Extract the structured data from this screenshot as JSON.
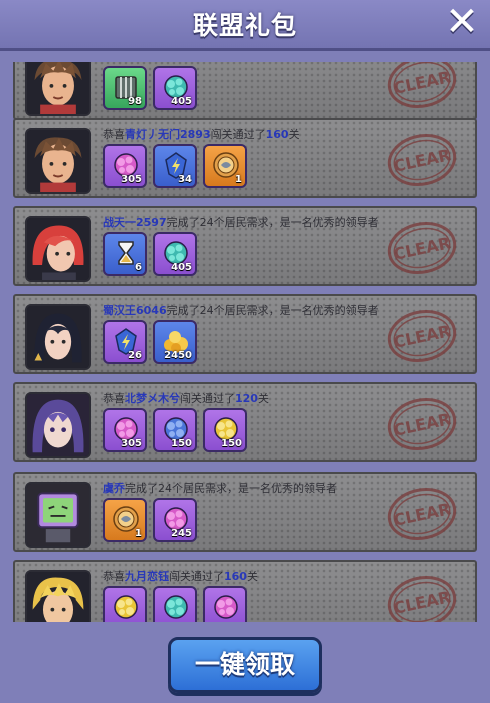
{
  "header": {
    "title": "联盟礼包",
    "close_icon": "close-icon"
  },
  "colors": {
    "highlight": "#2838b8",
    "panel": "#7f7fb8",
    "button": "#3b80e0"
  },
  "cards": [
    {
      "avatar": "avatar-brown-hair",
      "message": [],
      "stamp": "CLEAR",
      "items": [
        {
          "icon": "cage-icon",
          "color": "green",
          "count": "98"
        },
        {
          "icon": "teal-orb-icon",
          "color": "purple",
          "count": "405"
        }
      ]
    },
    {
      "avatar": "avatar-brown-hair",
      "message": [
        {
          "t": "恭喜",
          "hl": false
        },
        {
          "t": "青灯丿无门2893",
          "hl": true
        },
        {
          "t": "闯关通过了",
          "hl": false
        },
        {
          "t": "160",
          "hl": true
        },
        {
          "t": "关",
          "hl": false
        }
      ],
      "stamp": "CLEAR",
      "items": [
        {
          "icon": "pink-orb-icon",
          "color": "purple",
          "count": "305"
        },
        {
          "icon": "lightning-crystal-icon",
          "color": "blue",
          "count": "34"
        },
        {
          "icon": "gold-medal-icon",
          "color": "orange",
          "count": "1"
        }
      ]
    },
    {
      "avatar": "avatar-red-hair",
      "message": [
        {
          "t": "战天一2597",
          "hl": true
        },
        {
          "t": "完成了24个居民需求，是一名优秀的领导者",
          "hl": false
        }
      ],
      "stamp": "CLEAR",
      "items": [
        {
          "icon": "hourglass-icon",
          "color": "blue",
          "count": "6"
        },
        {
          "icon": "teal-orb-icon",
          "color": "purple",
          "count": "405"
        }
      ]
    },
    {
      "avatar": "avatar-dark-hair",
      "message": [
        {
          "t": "蜀汉王6046",
          "hl": true
        },
        {
          "t": "完成了24个居民需求，是一名优秀的领导者",
          "hl": false
        }
      ],
      "stamp": "CLEAR",
      "items": [
        {
          "icon": "lightning-crystal-icon",
          "color": "purple",
          "count": "26"
        },
        {
          "icon": "gold-pile-icon",
          "color": "blue",
          "count": "2450"
        }
      ]
    },
    {
      "avatar": "avatar-purple-hair",
      "message": [
        {
          "t": "恭喜",
          "hl": false
        },
        {
          "t": "北梦メ木兮",
          "hl": true
        },
        {
          "t": "闯关通过了",
          "hl": false
        },
        {
          "t": "120",
          "hl": true
        },
        {
          "t": "关",
          "hl": false
        }
      ],
      "stamp": "CLEAR",
      "items": [
        {
          "icon": "pink-orb-icon",
          "color": "purple",
          "count": "305"
        },
        {
          "icon": "blue-orb-icon",
          "color": "purple",
          "count": "150"
        },
        {
          "icon": "yellow-orb-icon",
          "color": "purple",
          "count": "150"
        }
      ]
    },
    {
      "avatar": "avatar-robot",
      "message": [
        {
          "t": "虞乔",
          "hl": true
        },
        {
          "t": "完成了24个居民需求，是一名优秀的领导者",
          "hl": false
        }
      ],
      "stamp": "CLEAR",
      "items": [
        {
          "icon": "gold-medal-icon",
          "color": "orange",
          "count": "1"
        },
        {
          "icon": "pink-orb-icon",
          "color": "purple",
          "count": "245"
        }
      ]
    },
    {
      "avatar": "avatar-blonde",
      "message": [
        {
          "t": "恭喜",
          "hl": false
        },
        {
          "t": "九月恋钰",
          "hl": true
        },
        {
          "t": "闯关通过了",
          "hl": false
        },
        {
          "t": "160",
          "hl": true
        },
        {
          "t": "关",
          "hl": false
        }
      ],
      "stamp": "CLEAR",
      "items": [
        {
          "icon": "yellow-orb-icon",
          "color": "purple",
          "count": ""
        },
        {
          "icon": "teal-orb-icon",
          "color": "purple",
          "count": ""
        },
        {
          "icon": "pink-orb-icon",
          "color": "purple",
          "count": ""
        }
      ]
    }
  ],
  "claim_button": {
    "label": "一键领取"
  }
}
